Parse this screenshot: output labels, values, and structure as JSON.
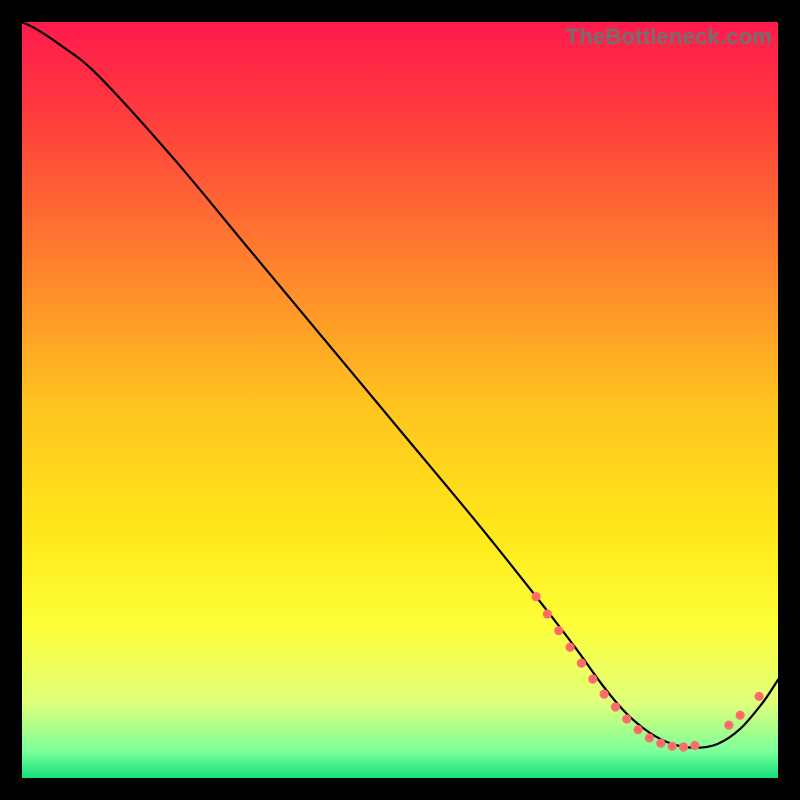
{
  "watermark": "TheBottleneck.com",
  "chart_data": {
    "type": "line",
    "title": "",
    "xlabel": "",
    "ylabel": "",
    "xlim": [
      0,
      100
    ],
    "ylim": [
      0,
      100
    ],
    "grid": false,
    "legend": false,
    "background_gradient": {
      "stops": [
        {
          "offset": 0.0,
          "color": "#ff1a4d"
        },
        {
          "offset": 0.12,
          "color": "#ff3b3d"
        },
        {
          "offset": 0.3,
          "color": "#ff7a2f"
        },
        {
          "offset": 0.5,
          "color": "#ffc21f"
        },
        {
          "offset": 0.68,
          "color": "#ffe91a"
        },
        {
          "offset": 0.8,
          "color": "#fdff3a"
        },
        {
          "offset": 0.9,
          "color": "#e0ff7a"
        },
        {
          "offset": 0.965,
          "color": "#7bff9a"
        },
        {
          "offset": 1.0,
          "color": "#14e07a"
        }
      ]
    },
    "series": [
      {
        "name": "curve",
        "color": "#000000",
        "x": [
          0,
          2,
          5,
          10,
          20,
          30,
          40,
          50,
          60,
          68,
          73,
          77,
          80,
          83,
          86,
          89,
          92,
          95,
          98,
          100
        ],
        "y": [
          100,
          99,
          97,
          93,
          82,
          70,
          58,
          46,
          34,
          24,
          17.5,
          12,
          8.5,
          6,
          4.5,
          4,
          4.5,
          6.5,
          10,
          13
        ]
      }
    ],
    "markers": {
      "name": "highlight-points",
      "color": "#ff6a6a",
      "stroke": "#ff6a6a",
      "radius": 4.6,
      "points": [
        {
          "x": 68.0,
          "y": 24.0
        },
        {
          "x": 69.5,
          "y": 21.7
        },
        {
          "x": 71.0,
          "y": 19.5
        },
        {
          "x": 72.5,
          "y": 17.3
        },
        {
          "x": 74.0,
          "y": 15.2
        },
        {
          "x": 75.5,
          "y": 13.1
        },
        {
          "x": 77.0,
          "y": 11.1
        },
        {
          "x": 78.5,
          "y": 9.4
        },
        {
          "x": 80.0,
          "y": 7.8
        },
        {
          "x": 81.5,
          "y": 6.4
        },
        {
          "x": 83.0,
          "y": 5.3
        },
        {
          "x": 84.5,
          "y": 4.6
        },
        {
          "x": 86.0,
          "y": 4.2
        },
        {
          "x": 87.5,
          "y": 4.1
        },
        {
          "x": 89.0,
          "y": 4.3
        },
        {
          "x": 93.5,
          "y": 7.0
        },
        {
          "x": 95.0,
          "y": 8.3
        },
        {
          "x": 97.5,
          "y": 10.8
        }
      ]
    }
  }
}
